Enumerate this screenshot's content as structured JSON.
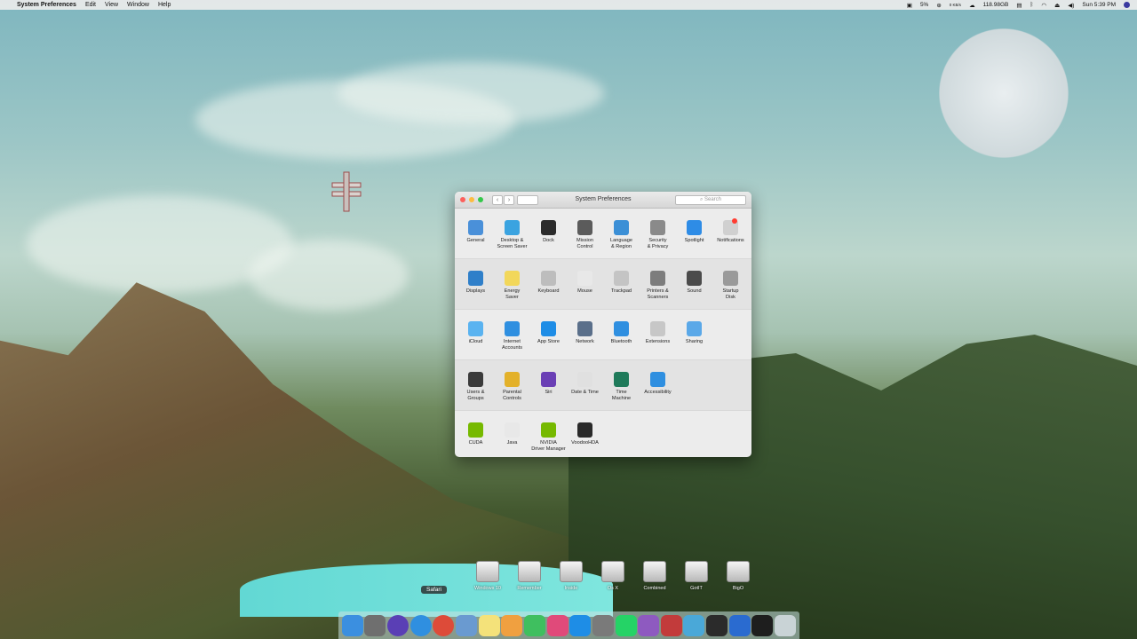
{
  "menubar": {
    "app_name": "System Preferences",
    "menus": [
      "Edit",
      "View",
      "Window",
      "Help"
    ],
    "status": {
      "battery": "5%",
      "network_rates": "0 KB/s",
      "disk": "118.98GB",
      "clock": "Sun 5:39 PM"
    }
  },
  "window": {
    "title": "System Preferences",
    "search_placeholder": "Search",
    "sections": [
      [
        {
          "label": "General",
          "icon": "general-icon",
          "color": "#4a90d9"
        },
        {
          "label": "Desktop &\nScreen Saver",
          "icon": "desktop-icon",
          "color": "#3aa3e0"
        },
        {
          "label": "Dock",
          "icon": "dock-icon",
          "color": "#2b2b2b"
        },
        {
          "label": "Mission\nControl",
          "icon": "mission-control-icon",
          "color": "#5b5b5b"
        },
        {
          "label": "Language\n& Region",
          "icon": "globe-flag-icon",
          "color": "#3b8fd6"
        },
        {
          "label": "Security\n& Privacy",
          "icon": "house-lock-icon",
          "color": "#8a8a8a"
        },
        {
          "label": "Spotlight",
          "icon": "magnifier-icon",
          "color": "#2e8ce6"
        },
        {
          "label": "Notifications",
          "icon": "notifications-icon",
          "color": "#d0d0d0"
        }
      ],
      [
        {
          "label": "Displays",
          "icon": "display-icon",
          "color": "#2f7fc9"
        },
        {
          "label": "Energy\nSaver",
          "icon": "lightbulb-icon",
          "color": "#f2d75a"
        },
        {
          "label": "Keyboard",
          "icon": "keyboard-icon",
          "color": "#bdbdbd"
        },
        {
          "label": "Mouse",
          "icon": "mouse-icon",
          "color": "#e8e8e8"
        },
        {
          "label": "Trackpad",
          "icon": "trackpad-icon",
          "color": "#c4c4c4"
        },
        {
          "label": "Printers &\nScanners",
          "icon": "printer-icon",
          "color": "#7d7d7d"
        },
        {
          "label": "Sound",
          "icon": "speaker-icon",
          "color": "#4b4b4b"
        },
        {
          "label": "Startup\nDisk",
          "icon": "disk-icon",
          "color": "#9a9a9a"
        }
      ],
      [
        {
          "label": "iCloud",
          "icon": "icloud-icon",
          "color": "#5ab3f0"
        },
        {
          "label": "Internet\nAccounts",
          "icon": "at-sign-icon",
          "color": "#2f8fe0"
        },
        {
          "label": "App Store",
          "icon": "app-store-icon",
          "color": "#1e8de6"
        },
        {
          "label": "Network",
          "icon": "network-globe-icon",
          "color": "#5a6f8a"
        },
        {
          "label": "Bluetooth",
          "icon": "bluetooth-icon",
          "color": "#2f8fe0"
        },
        {
          "label": "Extensions",
          "icon": "puzzle-icon",
          "color": "#c7c7c7"
        },
        {
          "label": "Sharing",
          "icon": "sharing-folder-icon",
          "color": "#5aa8e8"
        }
      ],
      [
        {
          "label": "Users &\nGroups",
          "icon": "users-icon",
          "color": "#3b3b3b"
        },
        {
          "label": "Parental\nControls",
          "icon": "parental-icon",
          "color": "#e3b12a"
        },
        {
          "label": "Siri",
          "icon": "siri-icon",
          "color": "#6a3fb5"
        },
        {
          "label": "Date & Time",
          "icon": "clock-calendar-icon",
          "color": "#e0e0e0"
        },
        {
          "label": "Time\nMachine",
          "icon": "time-machine-icon",
          "color": "#1f7a5a"
        },
        {
          "label": "Accessibility",
          "icon": "accessibility-icon",
          "color": "#2f8fe0"
        }
      ],
      [
        {
          "label": "CUDA",
          "icon": "nvidia-icon",
          "color": "#76b900"
        },
        {
          "label": "Java",
          "icon": "java-icon",
          "color": "#e8e8e8"
        },
        {
          "label": "NVIDIA\nDriver Manager",
          "icon": "nvidia-icon",
          "color": "#76b900"
        },
        {
          "label": "VoodooHDA",
          "icon": "voodoo-speaker-icon",
          "color": "#2a2a2a"
        }
      ]
    ]
  },
  "desktop_drives": [
    "Windows 10",
    "Remember",
    "Inside",
    "Os X",
    "Combined",
    "GotIT",
    "BigO"
  ],
  "dock": {
    "tooltip": "Safari",
    "apps": [
      {
        "name": "finder-icon",
        "color": "#3b8fe0"
      },
      {
        "name": "launchpad-icon",
        "color": "#6f6f6f"
      },
      {
        "name": "siri-icon",
        "color": "#5a3fb5"
      },
      {
        "name": "safari-icon",
        "color": "#2f8fe0"
      },
      {
        "name": "chrome-icon",
        "color": "#dd4b39"
      },
      {
        "name": "preview-icon",
        "color": "#6a9ad0"
      },
      {
        "name": "notes-icon",
        "color": "#f4e27a"
      },
      {
        "name": "photos-icon",
        "color": "#f0a040"
      },
      {
        "name": "messages-icon",
        "color": "#3fbf5f"
      },
      {
        "name": "itunes-icon",
        "color": "#e04a7a"
      },
      {
        "name": "app-store-icon",
        "color": "#1e8de6"
      },
      {
        "name": "system-preferences-icon",
        "color": "#7a7a7a"
      },
      {
        "name": "whatsapp-icon",
        "color": "#25d366"
      },
      {
        "name": "podcasts-icon",
        "color": "#8e5ac0"
      },
      {
        "name": "photo-booth-icon",
        "color": "#c23b3b"
      },
      {
        "name": "books-icon",
        "color": "#4aa8d8"
      },
      {
        "name": "xbox-icon",
        "color": "#2b2b2b"
      },
      {
        "name": "downloads-icon",
        "color": "#2a6bd0"
      },
      {
        "name": "terminal-icon",
        "color": "#1e1e1e"
      },
      {
        "name": "trash-icon",
        "color": "#c9d3d6"
      }
    ]
  },
  "colors": {
    "close": "#fc605c",
    "minimize": "#fdbc40",
    "zoom": "#34c84a",
    "notification_badge": "#ff3b30"
  }
}
